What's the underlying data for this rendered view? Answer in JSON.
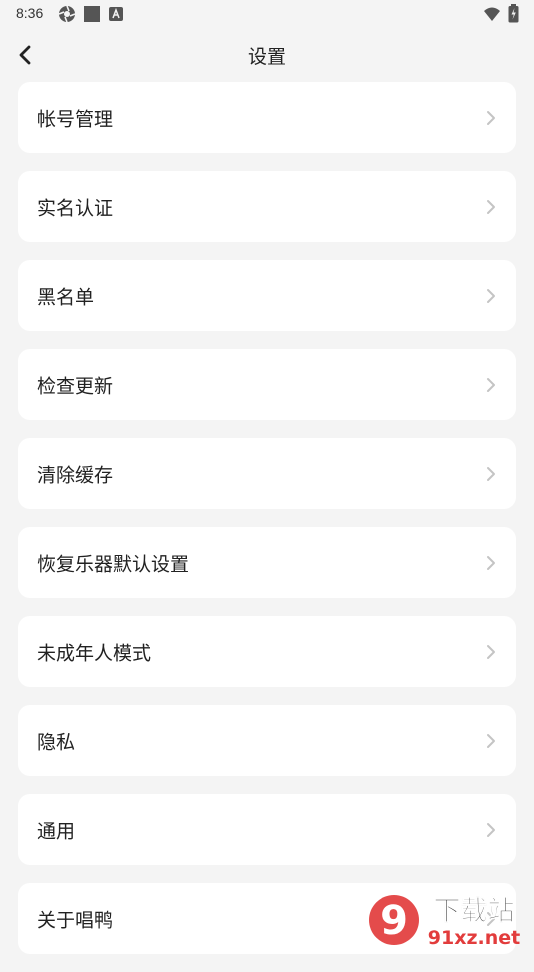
{
  "status_bar": {
    "time": "8:36"
  },
  "header": {
    "title": "设置"
  },
  "settings": {
    "items": [
      {
        "label": "帐号管理"
      },
      {
        "label": "实名认证"
      },
      {
        "label": "黑名单"
      },
      {
        "label": "检查更新"
      },
      {
        "label": "清除缓存"
      },
      {
        "label": "恢复乐器默认设置"
      },
      {
        "label": "未成年人模式"
      },
      {
        "label": "隐私"
      },
      {
        "label": "通用"
      },
      {
        "label": "关于唱鸭"
      }
    ]
  },
  "watermark": {
    "logo": "9",
    "title": "下载站",
    "domain": "91xz.net"
  },
  "colors": {
    "background": "#f4f4f4",
    "card": "#ffffff",
    "chevron": "#c4c4c4",
    "watermark_red": "#e23c3c"
  }
}
